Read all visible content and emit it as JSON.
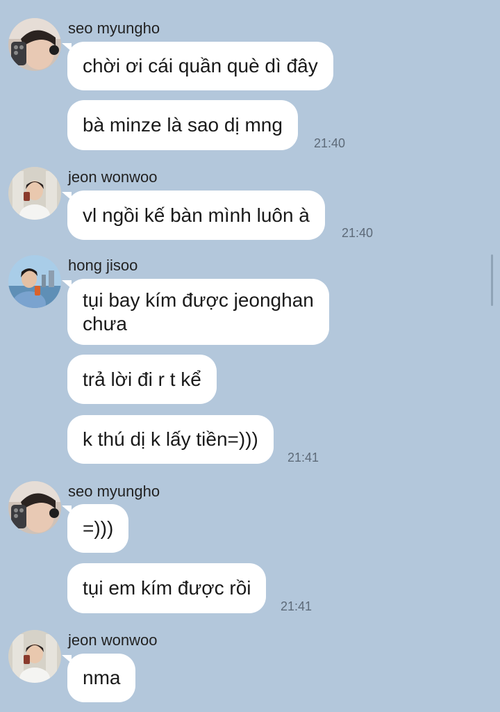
{
  "colors": {
    "background": "#b3c7db",
    "bubble": "#ffffff",
    "text": "#1a1a1a",
    "timestamp": "#5d6a78"
  },
  "messages": [
    {
      "sender": "seo myungho",
      "avatar_icon": "profile-photo-seo-myungho",
      "bubbles": [
        "chời ơi cái quần què dì đây",
        "bà minze là sao dị mng"
      ],
      "time": "21:40"
    },
    {
      "sender": "jeon wonwoo",
      "avatar_icon": "profile-photo-jeon-wonwoo",
      "bubbles": [
        "vl ngồi kế bàn mình luôn à"
      ],
      "time": "21:40"
    },
    {
      "sender": "hong jisoo",
      "avatar_icon": "profile-photo-hong-jisoo",
      "bubbles": [
        "tụi bay kím được jeonghan\nchưa",
        "trả lời đi r t kể",
        "k thú dị k lấy tiền=)))"
      ],
      "time": "21:41"
    },
    {
      "sender": "seo myungho",
      "avatar_icon": "profile-photo-seo-myungho",
      "bubbles": [
        "=)))",
        "tụi em kím được rồi"
      ],
      "time": "21:41"
    },
    {
      "sender": "jeon wonwoo",
      "avatar_icon": "profile-photo-jeon-wonwoo",
      "bubbles": [
        "nma"
      ],
      "time": ""
    }
  ]
}
